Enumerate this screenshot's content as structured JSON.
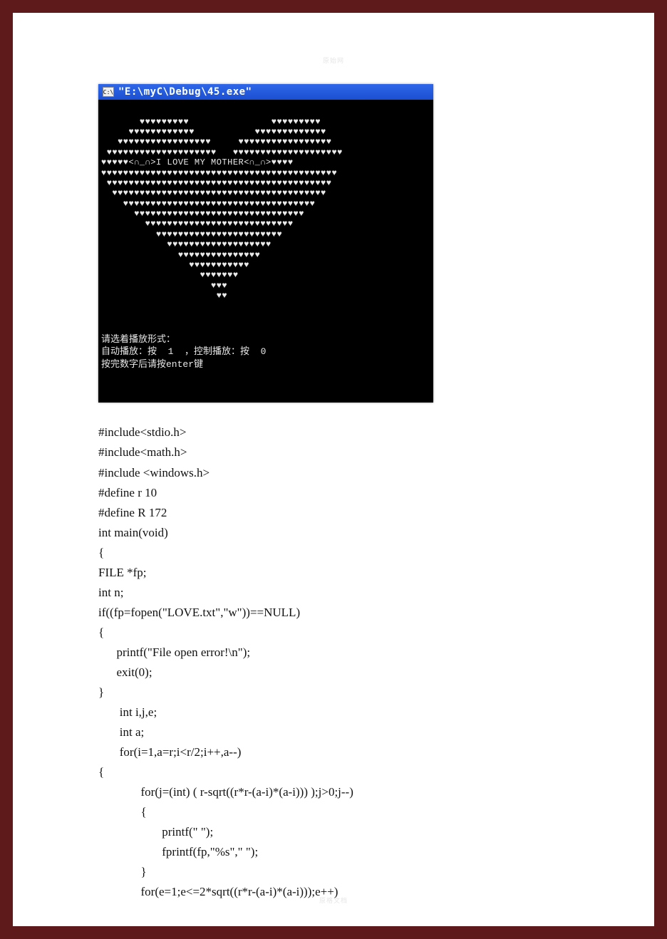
{
  "watermarks": {
    "top": "原始网",
    "bottom": "原格文档"
  },
  "terminal": {
    "icon_label": "C:\\",
    "title": "\"E:\\myC\\Debug\\45.exe\"",
    "heart_lines": [
      "       ♥♥♥♥♥♥♥♥♥               ♥♥♥♥♥♥♥♥♥",
      "     ♥♥♥♥♥♥♥♥♥♥♥♥           ♥♥♥♥♥♥♥♥♥♥♥♥♥",
      "   ♥♥♥♥♥♥♥♥♥♥♥♥♥♥♥♥♥     ♥♥♥♥♥♥♥♥♥♥♥♥♥♥♥♥♥",
      " ♥♥♥♥♥♥♥♥♥♥♥♥♥♥♥♥♥♥♥♥   ♥♥♥♥♥♥♥♥♥♥♥♥♥♥♥♥♥♥♥♥",
      "♥♥♥♥♥<∩_∩>I LOVE MY MOTHER<∩_∩>♥♥♥♥",
      "♥♥♥♥♥♥♥♥♥♥♥♥♥♥♥♥♥♥♥♥♥♥♥♥♥♥♥♥♥♥♥♥♥♥♥♥♥♥♥♥♥♥♥",
      " ♥♥♥♥♥♥♥♥♥♥♥♥♥♥♥♥♥♥♥♥♥♥♥♥♥♥♥♥♥♥♥♥♥♥♥♥♥♥♥♥♥",
      "  ♥♥♥♥♥♥♥♥♥♥♥♥♥♥♥♥♥♥♥♥♥♥♥♥♥♥♥♥♥♥♥♥♥♥♥♥♥♥♥",
      "    ♥♥♥♥♥♥♥♥♥♥♥♥♥♥♥♥♥♥♥♥♥♥♥♥♥♥♥♥♥♥♥♥♥♥♥",
      "      ♥♥♥♥♥♥♥♥♥♥♥♥♥♥♥♥♥♥♥♥♥♥♥♥♥♥♥♥♥♥♥",
      "        ♥♥♥♥♥♥♥♥♥♥♥♥♥♥♥♥♥♥♥♥♥♥♥♥♥♥♥",
      "          ♥♥♥♥♥♥♥♥♥♥♥♥♥♥♥♥♥♥♥♥♥♥♥",
      "            ♥♥♥♥♥♥♥♥♥♥♥♥♥♥♥♥♥♥♥",
      "              ♥♥♥♥♥♥♥♥♥♥♥♥♥♥♥",
      "                ♥♥♥♥♥♥♥♥♥♥♥",
      "                  ♥♥♥♥♥♥♥",
      "                    ♥♥♥",
      "                     ♥♥"
    ],
    "prompt_lines": [
      "请选着播放形式：",
      "自动播放：按  1  ，控制播放：按  0",
      "按完数字后请按enter键"
    ]
  },
  "code": {
    "text": "#include<stdio.h>\n#include<math.h>\n#include <windows.h>\n#define r 10\n#define R 172\nint main(void)\n{\nFILE *fp;\nint n;\nif((fp=fopen(\"LOVE.txt\",\"w\"))==NULL)\n{\n      printf(\"File open error!\\n\");\n      exit(0);\n}\n       int i,j,e;\n       int a;\n       for(i=1,a=r;i<r/2;i++,a--)\n{\n              for(j=(int) ( r-sqrt((r*r-(a-i)*(a-i))) );j>0;j--)\n              {\n                     printf(\" \");\n                     fprintf(fp,\"%s\",\" \");\n              }\n              for(e=1;e<=2*sqrt((r*r-(a-i)*(a-i)));e++)"
  }
}
